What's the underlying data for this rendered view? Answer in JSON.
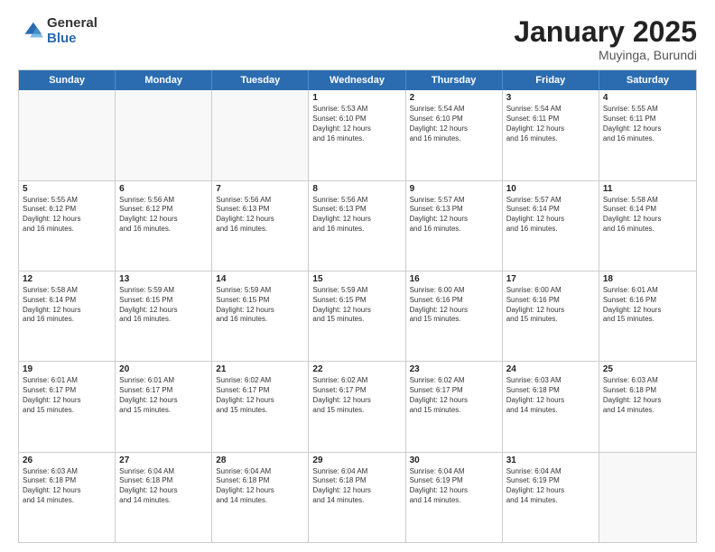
{
  "logo": {
    "general": "General",
    "blue": "Blue"
  },
  "header": {
    "month": "January 2025",
    "location": "Muyinga, Burundi"
  },
  "days": [
    "Sunday",
    "Monday",
    "Tuesday",
    "Wednesday",
    "Thursday",
    "Friday",
    "Saturday"
  ],
  "weeks": [
    [
      {
        "day": "",
        "content": ""
      },
      {
        "day": "",
        "content": ""
      },
      {
        "day": "",
        "content": ""
      },
      {
        "day": "1",
        "content": "Sunrise: 5:53 AM\nSunset: 6:10 PM\nDaylight: 12 hours\nand 16 minutes."
      },
      {
        "day": "2",
        "content": "Sunrise: 5:54 AM\nSunset: 6:10 PM\nDaylight: 12 hours\nand 16 minutes."
      },
      {
        "day": "3",
        "content": "Sunrise: 5:54 AM\nSunset: 6:11 PM\nDaylight: 12 hours\nand 16 minutes."
      },
      {
        "day": "4",
        "content": "Sunrise: 5:55 AM\nSunset: 6:11 PM\nDaylight: 12 hours\nand 16 minutes."
      }
    ],
    [
      {
        "day": "5",
        "content": "Sunrise: 5:55 AM\nSunset: 6:12 PM\nDaylight: 12 hours\nand 16 minutes."
      },
      {
        "day": "6",
        "content": "Sunrise: 5:56 AM\nSunset: 6:12 PM\nDaylight: 12 hours\nand 16 minutes."
      },
      {
        "day": "7",
        "content": "Sunrise: 5:56 AM\nSunset: 6:13 PM\nDaylight: 12 hours\nand 16 minutes."
      },
      {
        "day": "8",
        "content": "Sunrise: 5:56 AM\nSunset: 6:13 PM\nDaylight: 12 hours\nand 16 minutes."
      },
      {
        "day": "9",
        "content": "Sunrise: 5:57 AM\nSunset: 6:13 PM\nDaylight: 12 hours\nand 16 minutes."
      },
      {
        "day": "10",
        "content": "Sunrise: 5:57 AM\nSunset: 6:14 PM\nDaylight: 12 hours\nand 16 minutes."
      },
      {
        "day": "11",
        "content": "Sunrise: 5:58 AM\nSunset: 6:14 PM\nDaylight: 12 hours\nand 16 minutes."
      }
    ],
    [
      {
        "day": "12",
        "content": "Sunrise: 5:58 AM\nSunset: 6:14 PM\nDaylight: 12 hours\nand 16 minutes."
      },
      {
        "day": "13",
        "content": "Sunrise: 5:59 AM\nSunset: 6:15 PM\nDaylight: 12 hours\nand 16 minutes."
      },
      {
        "day": "14",
        "content": "Sunrise: 5:59 AM\nSunset: 6:15 PM\nDaylight: 12 hours\nand 16 minutes."
      },
      {
        "day": "15",
        "content": "Sunrise: 5:59 AM\nSunset: 6:15 PM\nDaylight: 12 hours\nand 15 minutes."
      },
      {
        "day": "16",
        "content": "Sunrise: 6:00 AM\nSunset: 6:16 PM\nDaylight: 12 hours\nand 15 minutes."
      },
      {
        "day": "17",
        "content": "Sunrise: 6:00 AM\nSunset: 6:16 PM\nDaylight: 12 hours\nand 15 minutes."
      },
      {
        "day": "18",
        "content": "Sunrise: 6:01 AM\nSunset: 6:16 PM\nDaylight: 12 hours\nand 15 minutes."
      }
    ],
    [
      {
        "day": "19",
        "content": "Sunrise: 6:01 AM\nSunset: 6:17 PM\nDaylight: 12 hours\nand 15 minutes."
      },
      {
        "day": "20",
        "content": "Sunrise: 6:01 AM\nSunset: 6:17 PM\nDaylight: 12 hours\nand 15 minutes."
      },
      {
        "day": "21",
        "content": "Sunrise: 6:02 AM\nSunset: 6:17 PM\nDaylight: 12 hours\nand 15 minutes."
      },
      {
        "day": "22",
        "content": "Sunrise: 6:02 AM\nSunset: 6:17 PM\nDaylight: 12 hours\nand 15 minutes."
      },
      {
        "day": "23",
        "content": "Sunrise: 6:02 AM\nSunset: 6:17 PM\nDaylight: 12 hours\nand 15 minutes."
      },
      {
        "day": "24",
        "content": "Sunrise: 6:03 AM\nSunset: 6:18 PM\nDaylight: 12 hours\nand 14 minutes."
      },
      {
        "day": "25",
        "content": "Sunrise: 6:03 AM\nSunset: 6:18 PM\nDaylight: 12 hours\nand 14 minutes."
      }
    ],
    [
      {
        "day": "26",
        "content": "Sunrise: 6:03 AM\nSunset: 6:18 PM\nDaylight: 12 hours\nand 14 minutes."
      },
      {
        "day": "27",
        "content": "Sunrise: 6:04 AM\nSunset: 6:18 PM\nDaylight: 12 hours\nand 14 minutes."
      },
      {
        "day": "28",
        "content": "Sunrise: 6:04 AM\nSunset: 6:18 PM\nDaylight: 12 hours\nand 14 minutes."
      },
      {
        "day": "29",
        "content": "Sunrise: 6:04 AM\nSunset: 6:18 PM\nDaylight: 12 hours\nand 14 minutes."
      },
      {
        "day": "30",
        "content": "Sunrise: 6:04 AM\nSunset: 6:19 PM\nDaylight: 12 hours\nand 14 minutes."
      },
      {
        "day": "31",
        "content": "Sunrise: 6:04 AM\nSunset: 6:19 PM\nDaylight: 12 hours\nand 14 minutes."
      },
      {
        "day": "",
        "content": ""
      }
    ]
  ]
}
